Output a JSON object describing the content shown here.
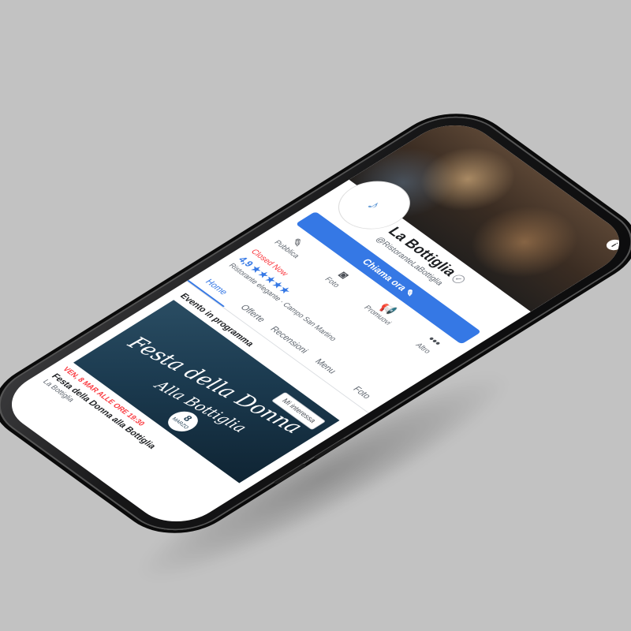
{
  "page": {
    "title": "La Bottiglia",
    "handle": "@RistoranteLaBottiglia",
    "cta_label": "Chiama ora",
    "cta_icon": "pencil-icon",
    "info_icon": "i"
  },
  "actions": [
    {
      "label": "Pubblica",
      "icon": "edit-icon",
      "glyph": "✎"
    },
    {
      "label": "Foto",
      "icon": "camera-icon",
      "glyph": "◙"
    },
    {
      "label": "Promuovi",
      "icon": "megaphone-icon",
      "glyph": "📢"
    },
    {
      "label": "Altro",
      "icon": "more-icon",
      "glyph": "•••"
    }
  ],
  "info": {
    "status": "Closed Now",
    "rating": "4,9",
    "stars": "★★★★★",
    "category": "Ristorante elegante · Campo San Martino"
  },
  "tabs": [
    {
      "label": "Home",
      "active": true
    },
    {
      "label": "Offerte",
      "active": false
    },
    {
      "label": "Recensioni",
      "active": false
    },
    {
      "label": "Menu",
      "active": false
    },
    {
      "label": "Foto",
      "active": false
    }
  ],
  "event": {
    "section_title": "Evento in programma",
    "image_title_1": "Festa della Donna",
    "image_title_2": "Alla Bottiglia",
    "badge_day": "8",
    "badge_month": "MARZO",
    "interest_label": "Mi interessa",
    "date": "VEN, 8 MAR ALLE ORE 19:30",
    "name": "Festa della Donna alla Bottiglia",
    "place": "La Bottiglia"
  },
  "colors": {
    "background": "#c2c2c2",
    "accent": "#3578e5",
    "alert": "#fa383e"
  }
}
